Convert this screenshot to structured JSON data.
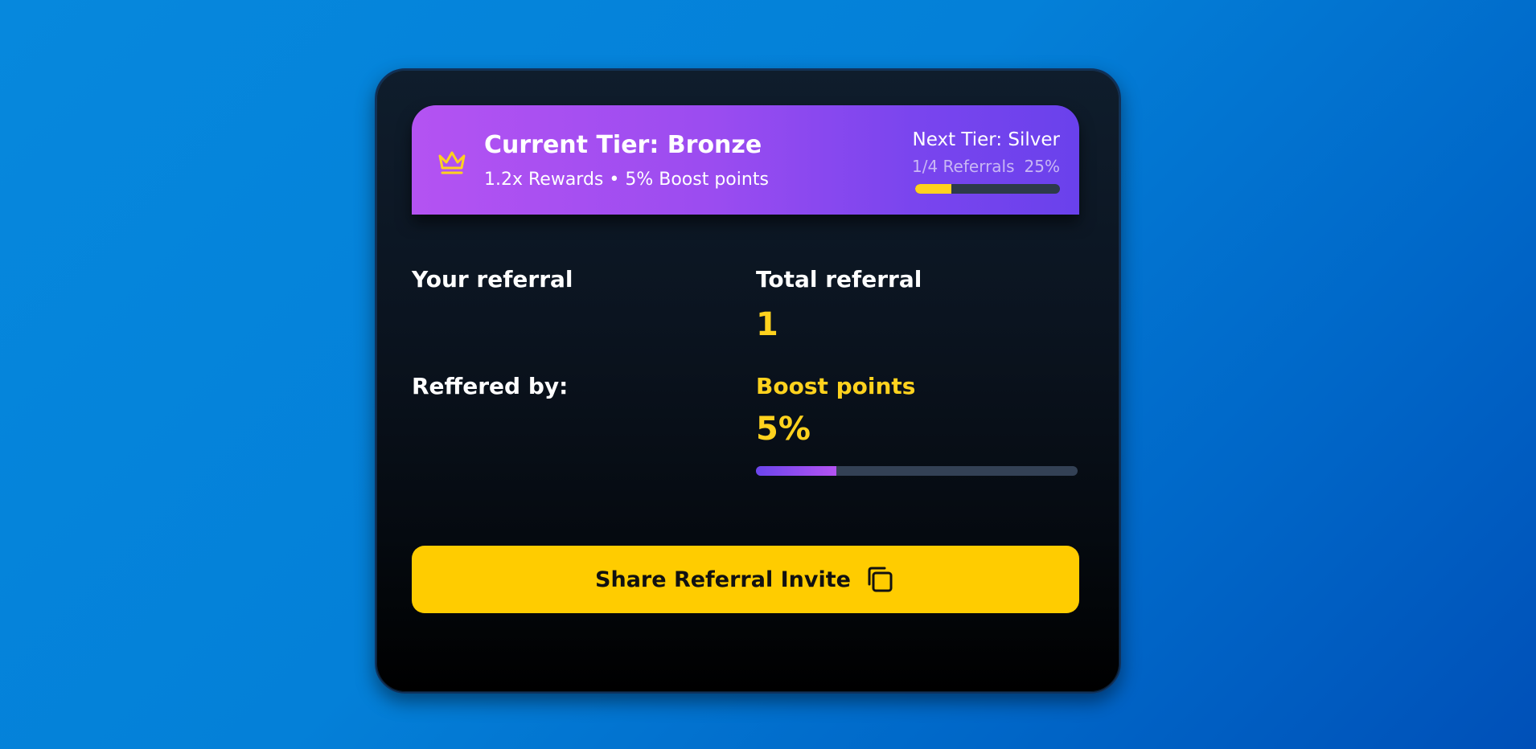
{
  "tier": {
    "title": "Current Tier: Bronze",
    "subtitle": "1.2x Rewards • 5% Boost points",
    "next_label": "Next Tier: Silver",
    "referrals_progress": "1/4 Referrals",
    "percent_label": "25%",
    "progress_fraction": 0.25,
    "crown_icon": "crown-icon",
    "colors": {
      "gradient_start": "#b453f2",
      "gradient_end": "#6a41ec",
      "accent": "#ffd21e"
    }
  },
  "stats": {
    "your_referral_label": "Your referral",
    "total_referral_label": "Total referral",
    "total_referral_value": "1",
    "referred_by_label": "Reffered by:",
    "boost_points_label": "Boost points",
    "boost_points_value": "5%",
    "boost_progress_fraction": 0.25
  },
  "share_button": {
    "label": "Share Referral Invite",
    "icon": "copy-icon",
    "color": "#ffcc00"
  }
}
